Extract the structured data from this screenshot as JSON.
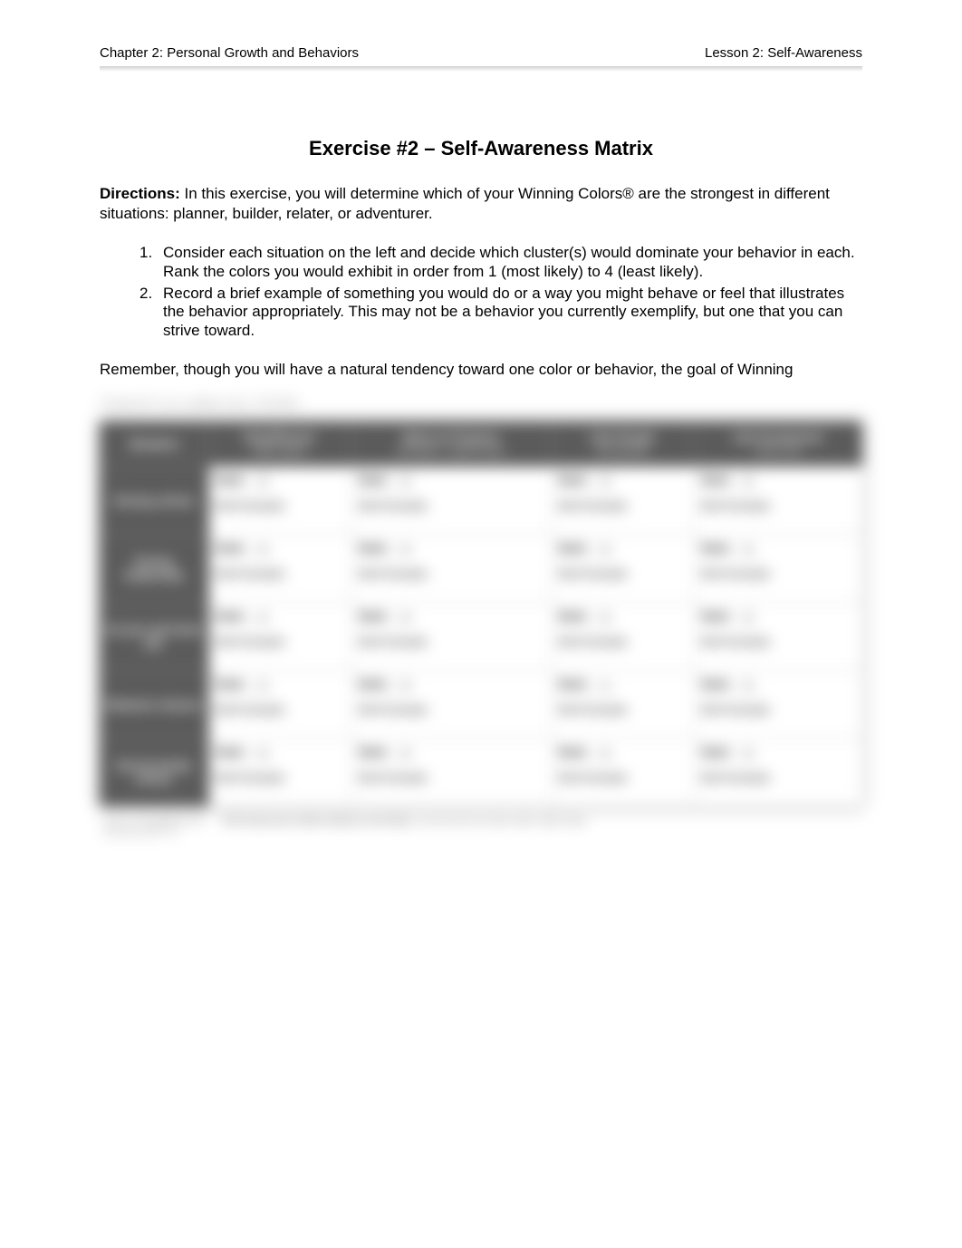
{
  "header": {
    "left": "Chapter 2: Personal Growth and Behaviors",
    "right": "Lesson 2: Self-Awareness"
  },
  "title": "Exercise #2 – Self-Awareness Matrix",
  "directions": {
    "label": "Directions:",
    "text": " In this exercise, you will determine which of your Winning Colors® are the strongest in different situations: planner, builder, relater, or adventurer."
  },
  "list": [
    {
      "num": "1.",
      "text": "Consider each situation on the left and decide which cluster(s) would dominate your behavior in each. Rank the colors you would exhibit in order from 1 (most likely) to 4 (least likely)."
    },
    {
      "num": "2.",
      "text": "Record a brief example of something you would do or a way you might behave or feel that illustrates the behavior appropriately. This may not be a behavior you currently exemplify, but one that you can strive toward."
    }
  ],
  "remember": "Remember, though you will have a natural tendency toward one color or behavior, the goal of Winning",
  "blur_line": "Colors® is to utilize ALL FOUR.",
  "columns": [
    {
      "title": "Situation",
      "sub": ""
    },
    {
      "title": "Plan/Planner",
      "sub": "prefer green"
    },
    {
      "title": "Work on Projects",
      "sub": "and Build – prefer brown"
    },
    {
      "title": "Like People",
      "sub": "and warmth"
    },
    {
      "title": "Like Excitement",
      "sub": "most of all"
    }
  ],
  "rows": [
    {
      "label": "During school"
    },
    {
      "label": "During leadership"
    },
    {
      "label": "At your part-time job"
    },
    {
      "label": "Between classes"
    },
    {
      "label": "During family events"
    }
  ],
  "cell": {
    "rank_label": "Rank:",
    "brief": "Brief Example:"
  },
  "ranks": [
    [
      "3",
      "3",
      "3",
      "3"
    ],
    [
      "4",
      "4",
      "4",
      "4"
    ],
    [
      "2",
      "4",
      "4",
      "4"
    ],
    [
      "2",
      "4",
      "1",
      "4"
    ],
    [
      "4",
      "4",
      "4",
      "4"
    ]
  ],
  "footer": {
    "left_line1": "Unit 3: Foundations for",
    "left_line2": "Success (LET 1)",
    "mid_bold": "Self-Awareness Matrix [Name and Date]",
    "mid_rest": " I recommend we take action right away.",
    "right": ""
  }
}
